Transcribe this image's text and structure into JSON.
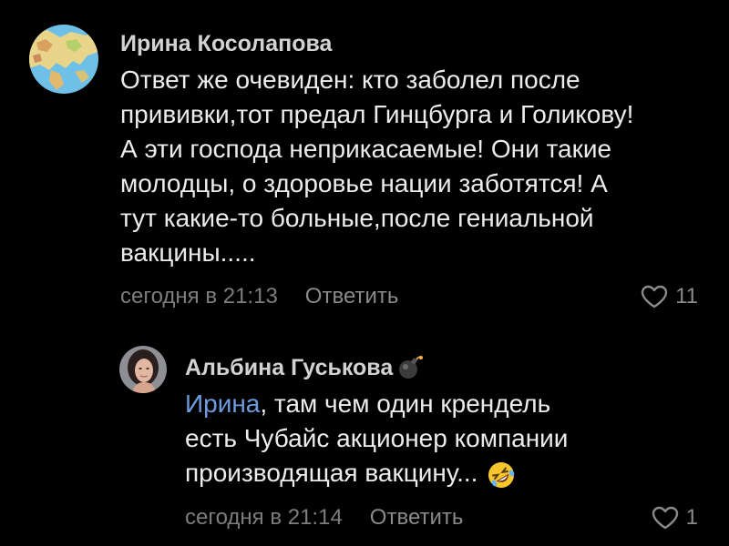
{
  "comment": {
    "author": "Ирина Косолапова",
    "lines": [
      "Ответ же очевиден: кто заболел после",
      "прививки,тот предал Гинцбурга и Голикову!",
      "А эти господа неприкасаемые! Они такие",
      "молодцы, о здоровье нации заботятся! А",
      "тут какие-то больные,после гениальной",
      "вакцины....."
    ],
    "timestamp": "сегодня в 21:13",
    "reply_label": "Ответить",
    "likes": "11"
  },
  "reply": {
    "author": "Альбина Гуськова",
    "author_badge_icon": "bomb-icon",
    "mention": "Ирина",
    "line1_rest": ", там чем один крендель",
    "line2": "есть Чубайс акционер компании",
    "line3": "производящая вакцину...",
    "end_emoji_icon": "rolling-on-floor-laughing-icon",
    "timestamp": "сегодня в 21:14",
    "reply_label": "Ответить",
    "likes": "1"
  },
  "colors": {
    "background": "#000000",
    "text": "#ececec",
    "muted": "#7d7d7d",
    "mention": "#6d9ce0"
  }
}
